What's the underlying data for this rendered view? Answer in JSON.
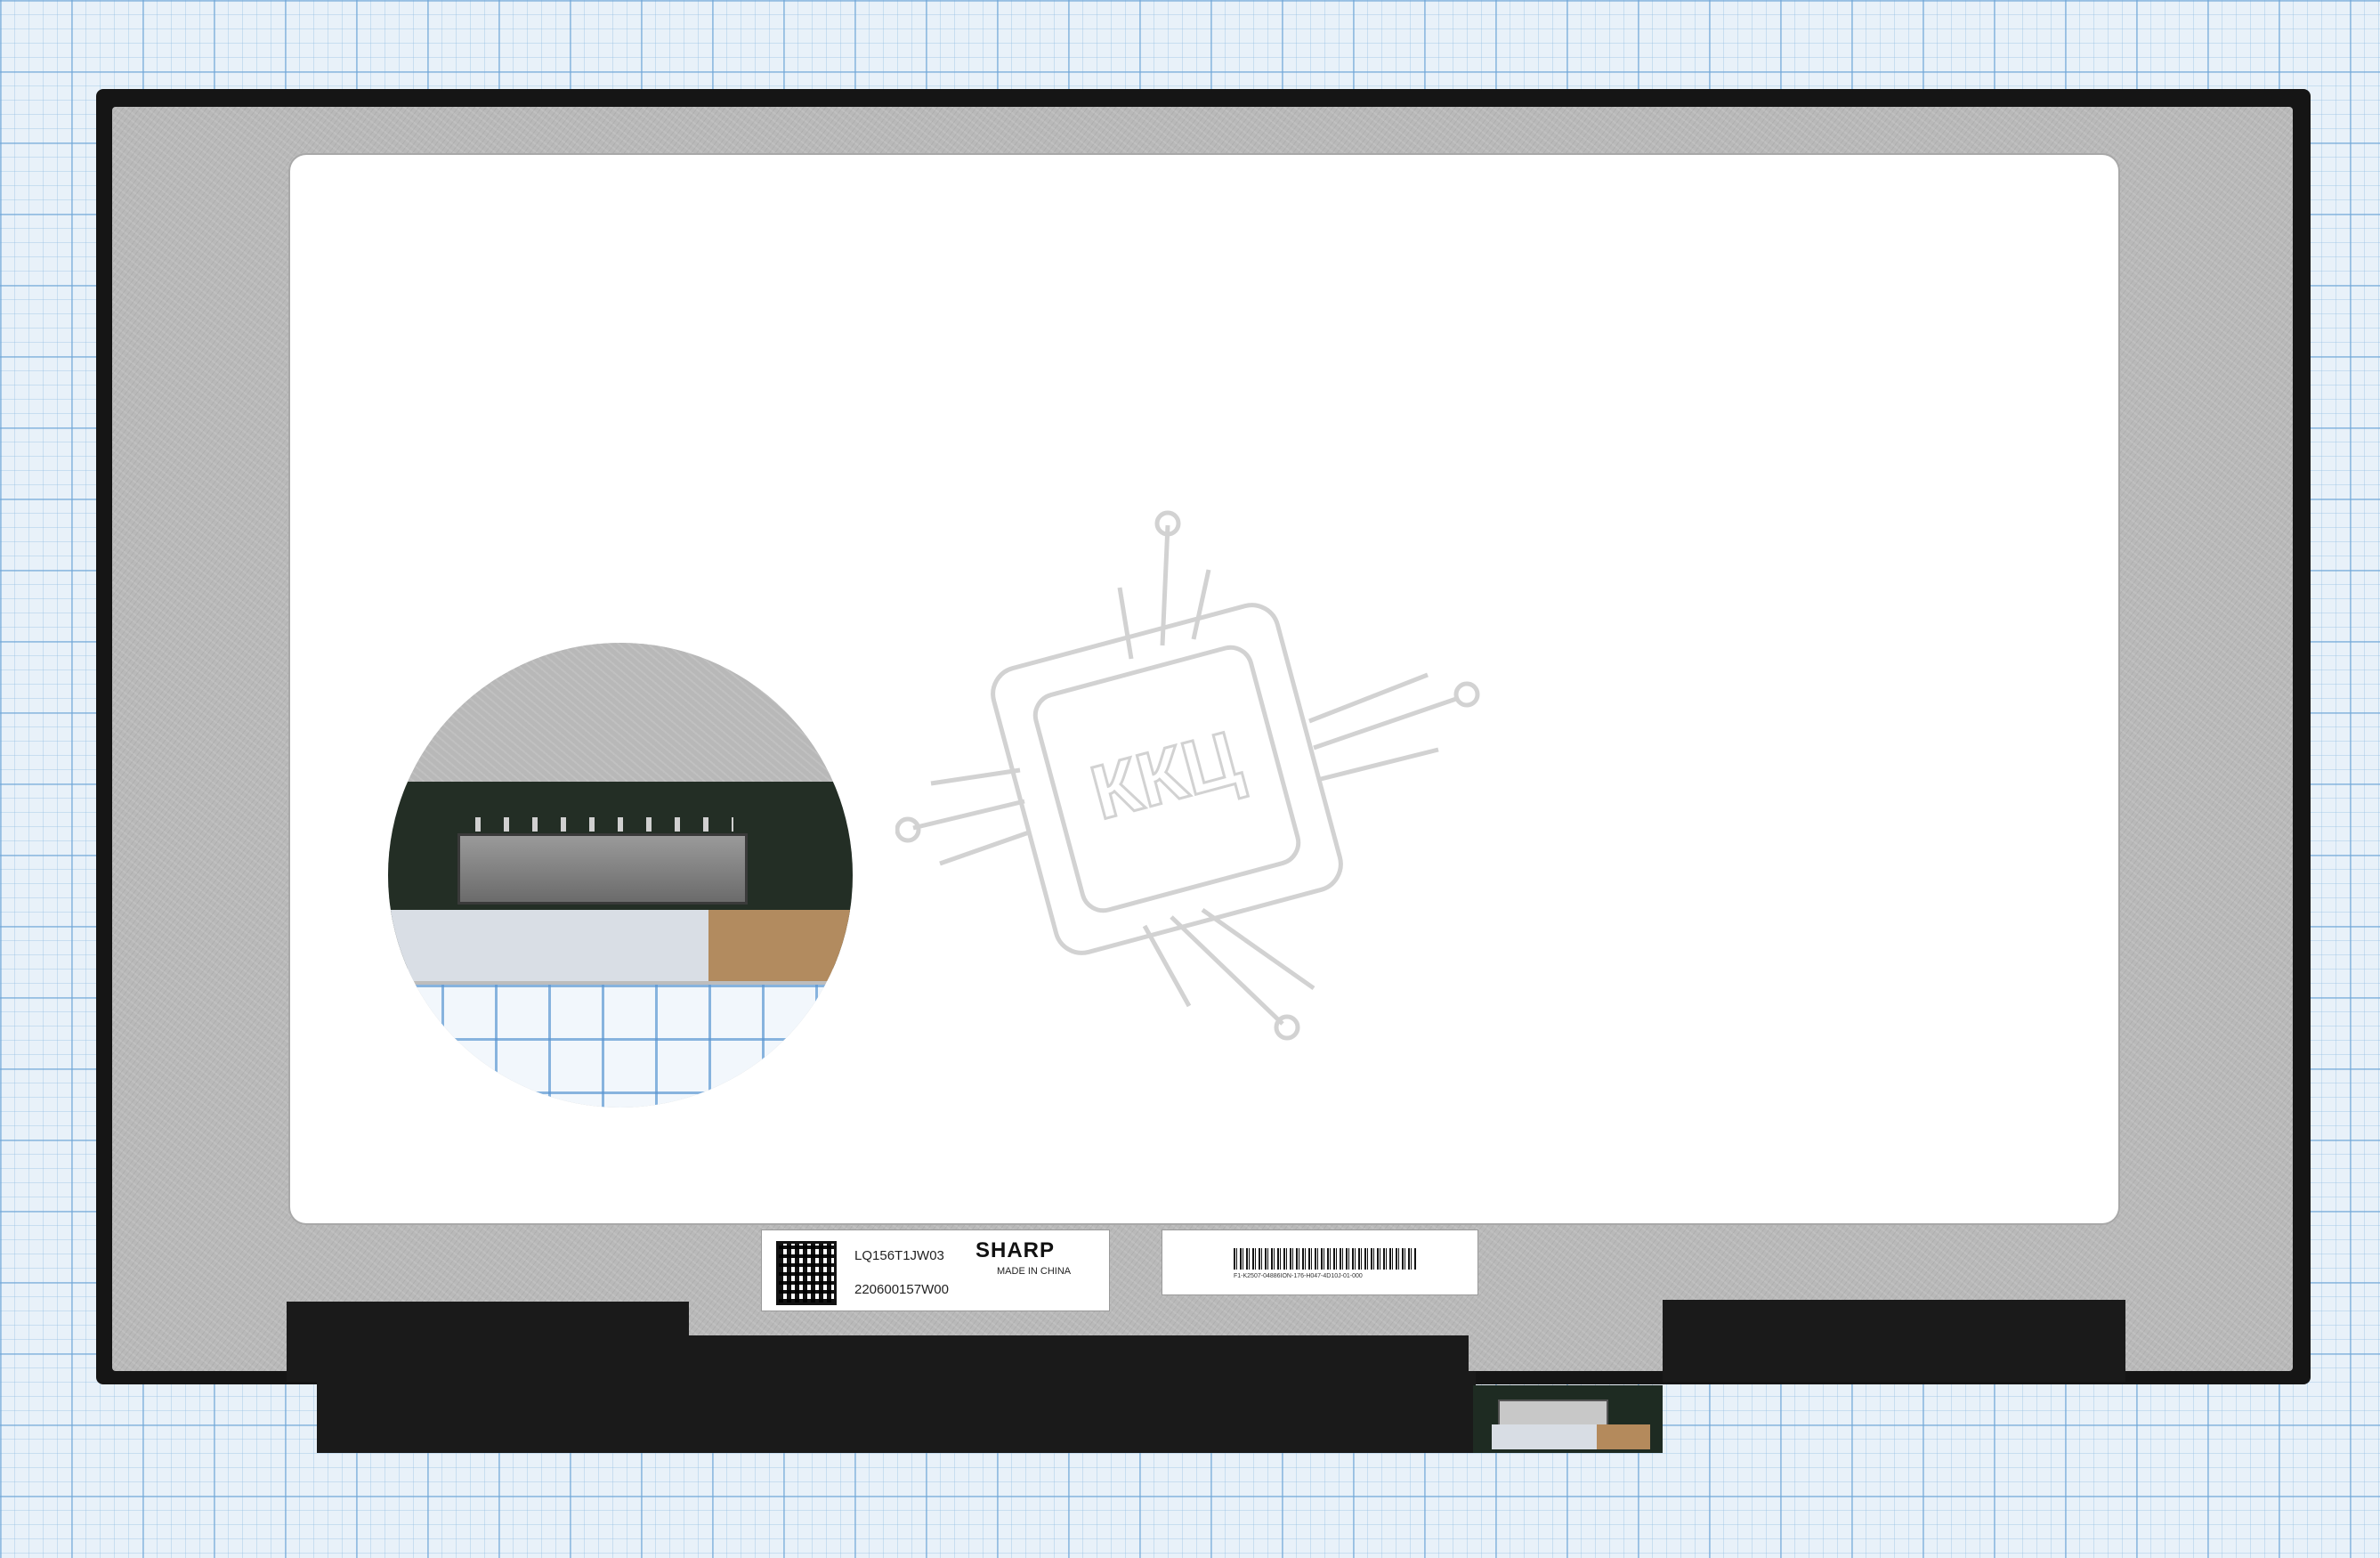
{
  "label_main": {
    "model": "LQ156T1JW03",
    "serial": "220600157W00",
    "brand": "SHARP",
    "made_in": "MADE IN CHINA"
  },
  "label_barcode": {
    "text": "F1-K2507-04886ION-176-H047-4D10J-01-000"
  },
  "watermark": {
    "text": "ККЦ"
  },
  "colors": {
    "bezel": "#151515",
    "metal": "#b9b9b9",
    "screen": "#ffffff",
    "grid_paper": "#e8f1f9",
    "watermark": "#d2d2d2"
  }
}
